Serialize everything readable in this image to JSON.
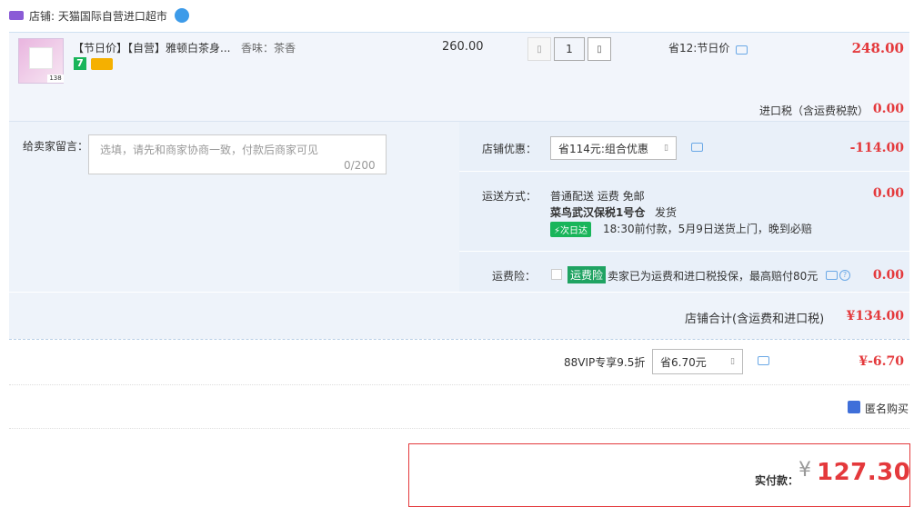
{
  "store": {
    "label": "店铺: 天猫国际自营进口超市"
  },
  "item": {
    "title": "【节日价】【自营】雅顿白茶身...",
    "attribute": "香味：茶香",
    "thumb_sale_tag": "138",
    "badge_num": "7",
    "unit_price": "260.00",
    "quantity": "1",
    "promo": "省12:节日价",
    "subtotal": "248.00",
    "import_tax_label": "进口税（含运费税款）",
    "import_tax_value": "0.00"
  },
  "message": {
    "label": "给卖家留言：",
    "placeholder": "选填，请先和商家协商一致，付款后商家可见",
    "counter": "0/200"
  },
  "discount": {
    "label": "店铺优惠：",
    "selected": "省114元:组合优惠",
    "value": "-114.00"
  },
  "shipping": {
    "label": "运送方式：",
    "method": "普通配送 运费 免邮",
    "warehouse": "菜鸟武汉保税1号仓",
    "ship_status": "发货",
    "next_day_badge": "次日达",
    "delivery_note": "18:30前付款，5月9日送货上门，晚到必赔",
    "value": "0.00"
  },
  "insurance": {
    "label": "运费险：",
    "badge": "运费险",
    "note": "卖家已为运费和进口税投保，最高赔付80元",
    "value": "0.00"
  },
  "store_total": {
    "label": "店铺合计(含运费和进口税)",
    "value": "¥134.00"
  },
  "vip": {
    "label": "88VIP专享9.5折",
    "selected": "省6.70元",
    "value": "¥-6.70"
  },
  "anonymous": {
    "label": "匿名购买"
  },
  "payment": {
    "label": "实付款：",
    "currency": "¥",
    "amount": "127.30"
  },
  "colors": {
    "price_red": "#e4393c",
    "panel_blue": "#eef3fa",
    "green": "#19b55a"
  }
}
